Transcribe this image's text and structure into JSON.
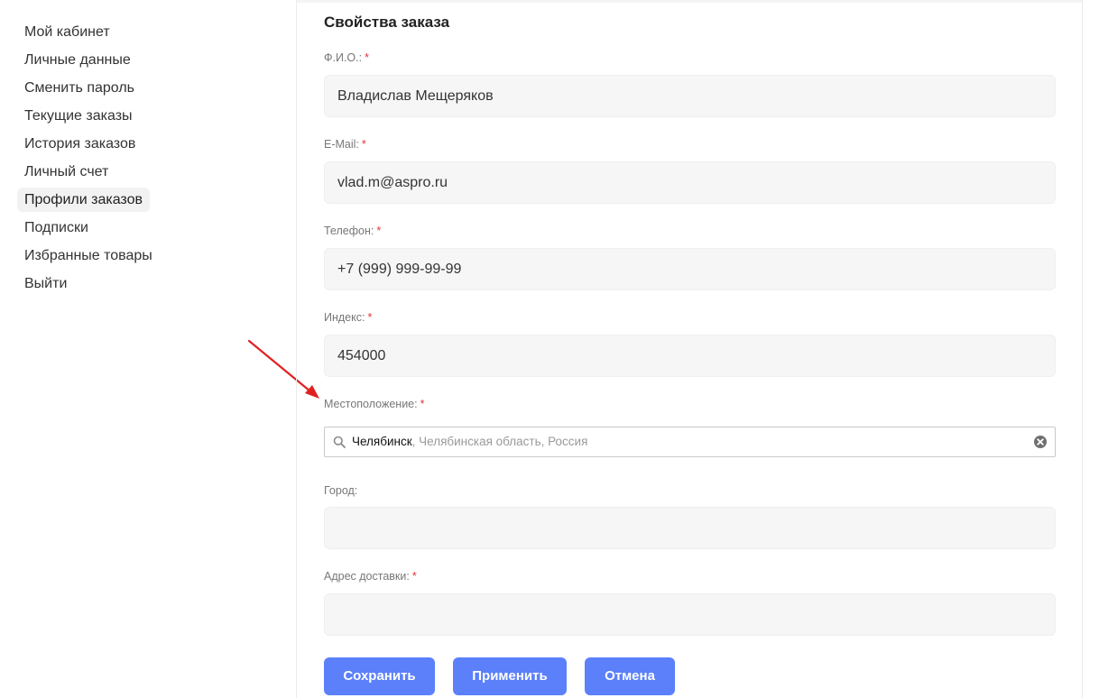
{
  "sidebar": {
    "items": [
      {
        "label": "Мой кабинет"
      },
      {
        "label": "Личные данные"
      },
      {
        "label": "Сменить пароль"
      },
      {
        "label": "Текущие заказы"
      },
      {
        "label": "История заказов"
      },
      {
        "label": "Личный счет"
      },
      {
        "label": "Профили заказов",
        "active": true
      },
      {
        "label": "Подписки"
      },
      {
        "label": "Избранные товары"
      },
      {
        "label": "Выйти"
      }
    ]
  },
  "form": {
    "title": "Свойства заказа",
    "required_mark": "*",
    "fields": {
      "fio": {
        "label": "Ф.И.О.:",
        "value": "Владислав Мещеряков",
        "required": true
      },
      "email": {
        "label": "E-Mail:",
        "value": "vlad.m@aspro.ru",
        "required": true
      },
      "phone": {
        "label": "Телефон:",
        "value": "+7 (999) 999-99-99",
        "required": true
      },
      "index": {
        "label": "Индекс:",
        "value": "454000",
        "required": true
      },
      "location": {
        "label": "Местоположение:",
        "city": "Челябинск",
        "rest": ", Челябинская область, Россия",
        "required": true,
        "icon": "search-icon",
        "clear_icon": "clear-icon"
      },
      "city": {
        "label": "Город:",
        "value": "",
        "required": false
      },
      "address": {
        "label": "Адрес доставки:",
        "value": "",
        "required": true
      }
    },
    "buttons": {
      "save": "Сохранить",
      "apply": "Применить",
      "cancel": "Отмена"
    }
  },
  "colors": {
    "accent": "#5b80fa",
    "required": "#e03535",
    "annotation_arrow": "#e02020"
  }
}
